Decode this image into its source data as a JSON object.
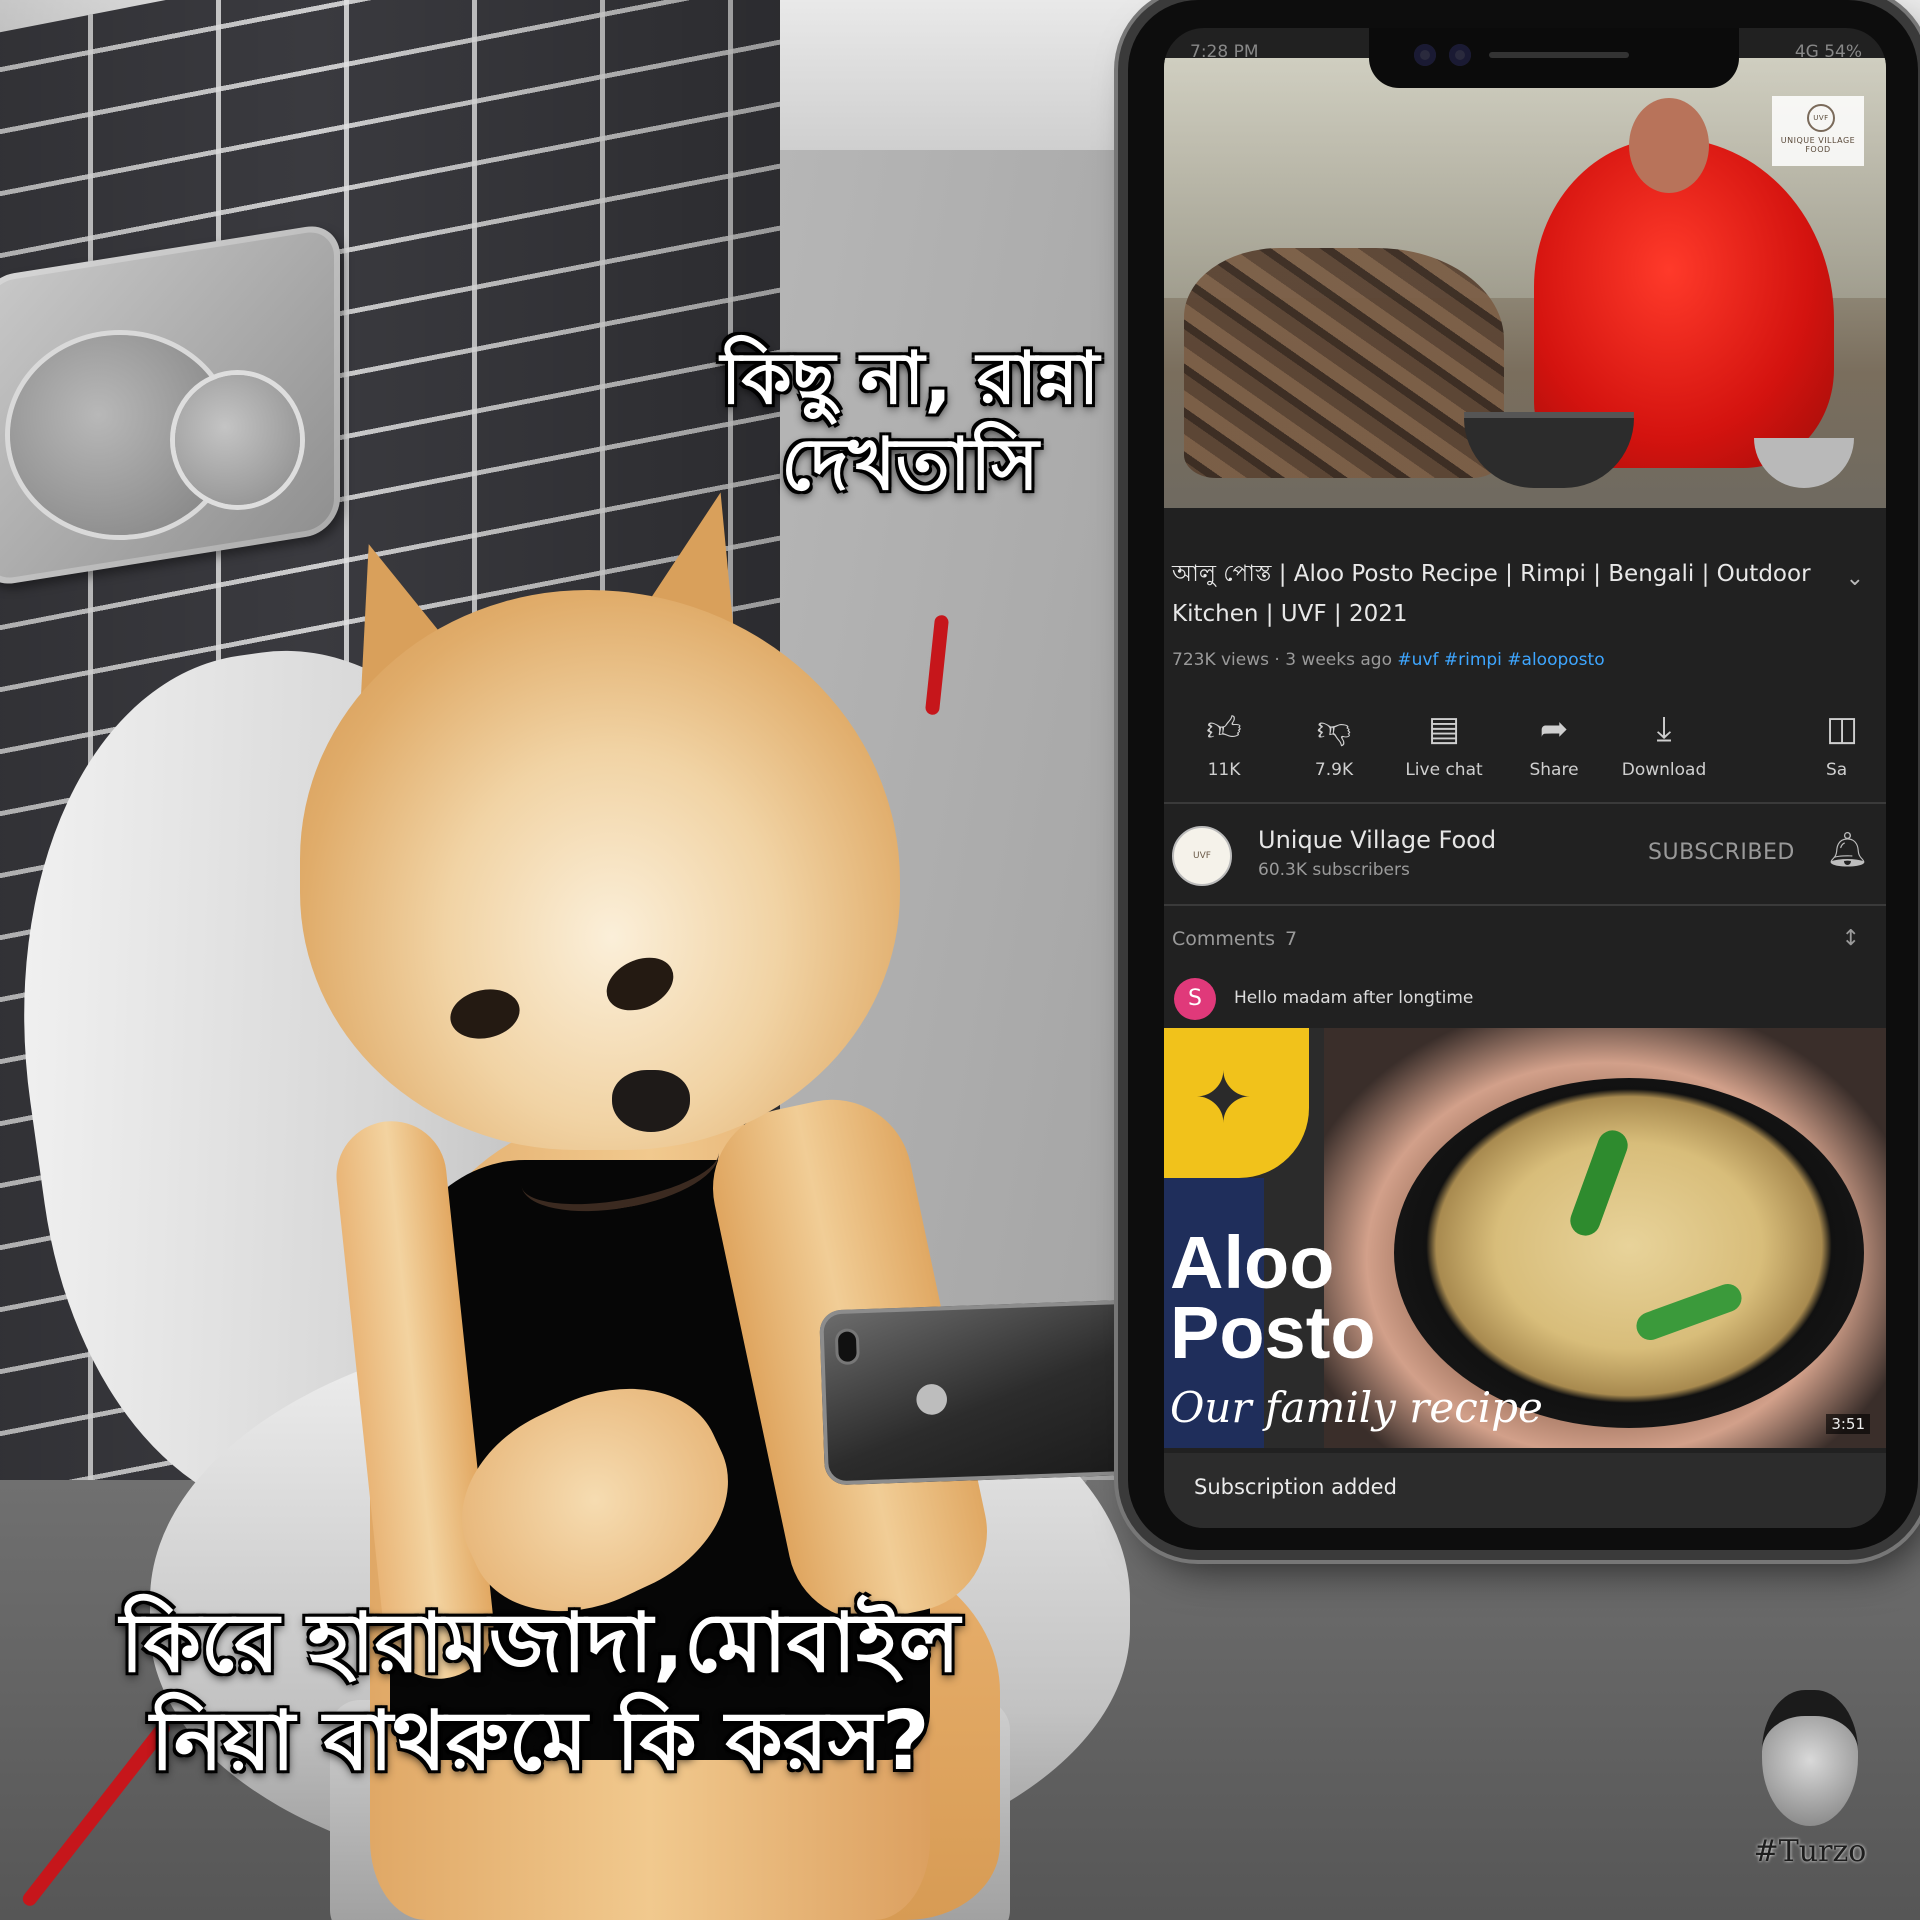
{
  "captions": {
    "top": "কিছু না, রান্না দেখতাসি",
    "bottom": "কিরে হারামজাদা,মোবাইল নিয়া বাথরুমে কি করস?"
  },
  "watermark": "#Turzo",
  "status_bar": {
    "time": "7:28 PM",
    "right": "4G  54%"
  },
  "video": {
    "title": "আলু পোস্ত | Aloo Posto Recipe | Rimpi | Bengali | Outdoor Kitchen | UVF | 2021",
    "views_age": "723K views · 3 weeks ago",
    "hashtags": "#uvf #rimpi #alooposto",
    "thumbnail_brand": "UNIQUE VILLAGE FOOD",
    "thumbnail_brand_short": "UVF"
  },
  "actions": [
    {
      "icon": "thumbs-up-icon",
      "label": "11K"
    },
    {
      "icon": "thumbs-down-icon",
      "label": "7.9K"
    },
    {
      "icon": "live-chat-icon",
      "label": "Live chat"
    },
    {
      "icon": "share-icon",
      "label": "Share"
    },
    {
      "icon": "download-icon",
      "label": "Download"
    },
    {
      "icon": "save-icon",
      "label": "Sa"
    }
  ],
  "channel": {
    "name": "Unique Village Food",
    "subscribers": "60.3K subscribers",
    "subscribe_state": "SUBSCRIBED"
  },
  "comments": {
    "label": "Comments",
    "count": "7",
    "first": {
      "avatar_letter": "S",
      "text": "Hello madam after longtime",
      "avatar_color": "#e0397a"
    }
  },
  "next_video": {
    "title_line1": "Aloo",
    "title_line2": "Posto",
    "subtitle": "Our family recipe",
    "duration": "3:51"
  },
  "toast": "Subscription added",
  "colors": {
    "link": "#3ea6ff",
    "background": "#212121",
    "caption_text": "#ffffff"
  }
}
